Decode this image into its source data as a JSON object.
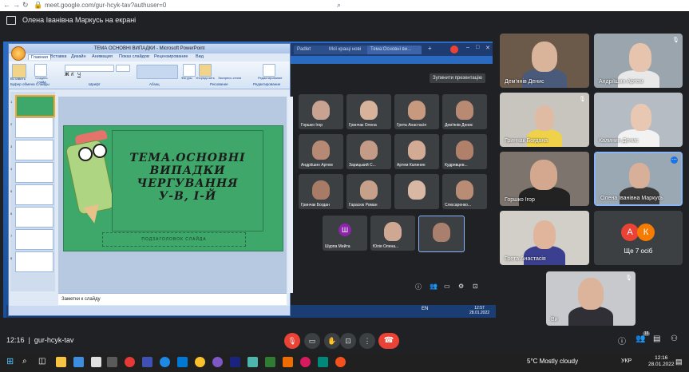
{
  "browser": {
    "url": "meet.google.com/gur-hcyk-tav?authuser=0"
  },
  "banner": {
    "text": "Олена Іванівна Маркусь на екрані"
  },
  "shared_screen": {
    "ppt_window_title": "ТЕМА ОСНОВНІ ВИПАДКИ - Microsoft PowerPoint",
    "ribbon_tabs": [
      "Главная",
      "Вставка",
      "Дизайн",
      "Анимация",
      "Показ слайдов",
      "Рецензирование",
      "Вид"
    ],
    "ribbon_groups": [
      "Буфер обмена",
      "Слайды",
      "Шрифт",
      "Абзац",
      "Рисование",
      "Редактирование"
    ],
    "ribbon_buttons": [
      "Вставить",
      "Создать слайд",
      "Фигуры",
      "Упорядочить",
      "Экспресс-стили",
      "Редактирование"
    ],
    "slide_title": "ТЕМА.ОСНОВНІ ВИПАДКИ ЧЕРГУВАННЯ У-В, І-Й",
    "slide_title_lines": [
      "ТЕМА.ОСНОВНІ",
      "ВИПАДКИ",
      "ЧЕРГУВАННЯ",
      "У-В, І-Й"
    ],
    "subtitle_placeholder": "ПОДЗАГОЛОВОК СЛАЙДА",
    "notes_placeholder": "Заметки к слайду",
    "thumbnail_numbers": [
      "1",
      "2",
      "3",
      "4",
      "5",
      "6",
      "7",
      "8"
    ],
    "browser_tabs": [
      "Padlet",
      "Мої кращі нові",
      "Тема:Основні ви..."
    ],
    "present_button": "Зупинити презентацію",
    "clock_time": "12:57",
    "clock_date": "28.01.2022",
    "mini_participants": [
      "Горшко Ігор",
      "Гринчак Олена",
      "Грета Анастасія",
      "Дем'янів Денис",
      "Андріїшин Артем",
      "Зарицький С...",
      "Артем Калинин",
      "Кудрявцев...",
      "Гринчак Богдан",
      "Гарасюк Роман",
      "",
      "Слюсаренко...",
      "Шурпа Мейта",
      "Юлія Олена...",
      ""
    ],
    "mini_avatar_letter": "Ш"
  },
  "participants": [
    {
      "name": "Дем'янів Денис",
      "muted": false
    },
    {
      "name": "Андріїшин Артем",
      "muted": true
    },
    {
      "name": "Гринчак Богдана",
      "muted": true
    },
    {
      "name": "Калинин Денис",
      "muted": false
    },
    {
      "name": "Горшко Ігор",
      "muted": false
    },
    {
      "name": "Олена Іванівна Маркусь",
      "muted": false
    },
    {
      "name": "Грета Анастасія",
      "muted": false
    },
    {
      "name": "Ще 7 осіб",
      "muted": false
    },
    {
      "name": "Ви",
      "muted": true
    }
  ],
  "others_avatars": [
    "А",
    "К"
  ],
  "bottom_bar": {
    "time": "12:16",
    "meeting_code": "gur-hcyk-tav",
    "people_count": "16"
  },
  "taskbar": {
    "weather": "5°C  Mostly cloudy",
    "lang": "УКР",
    "time": "12:16",
    "date": "28.01.2022"
  },
  "colors": {
    "meet_bg": "#202124",
    "tile_bg": "#3c4043",
    "end_call": "#ea4335",
    "slide_green": "#3da86a",
    "highlight": "#8ab4f8"
  }
}
